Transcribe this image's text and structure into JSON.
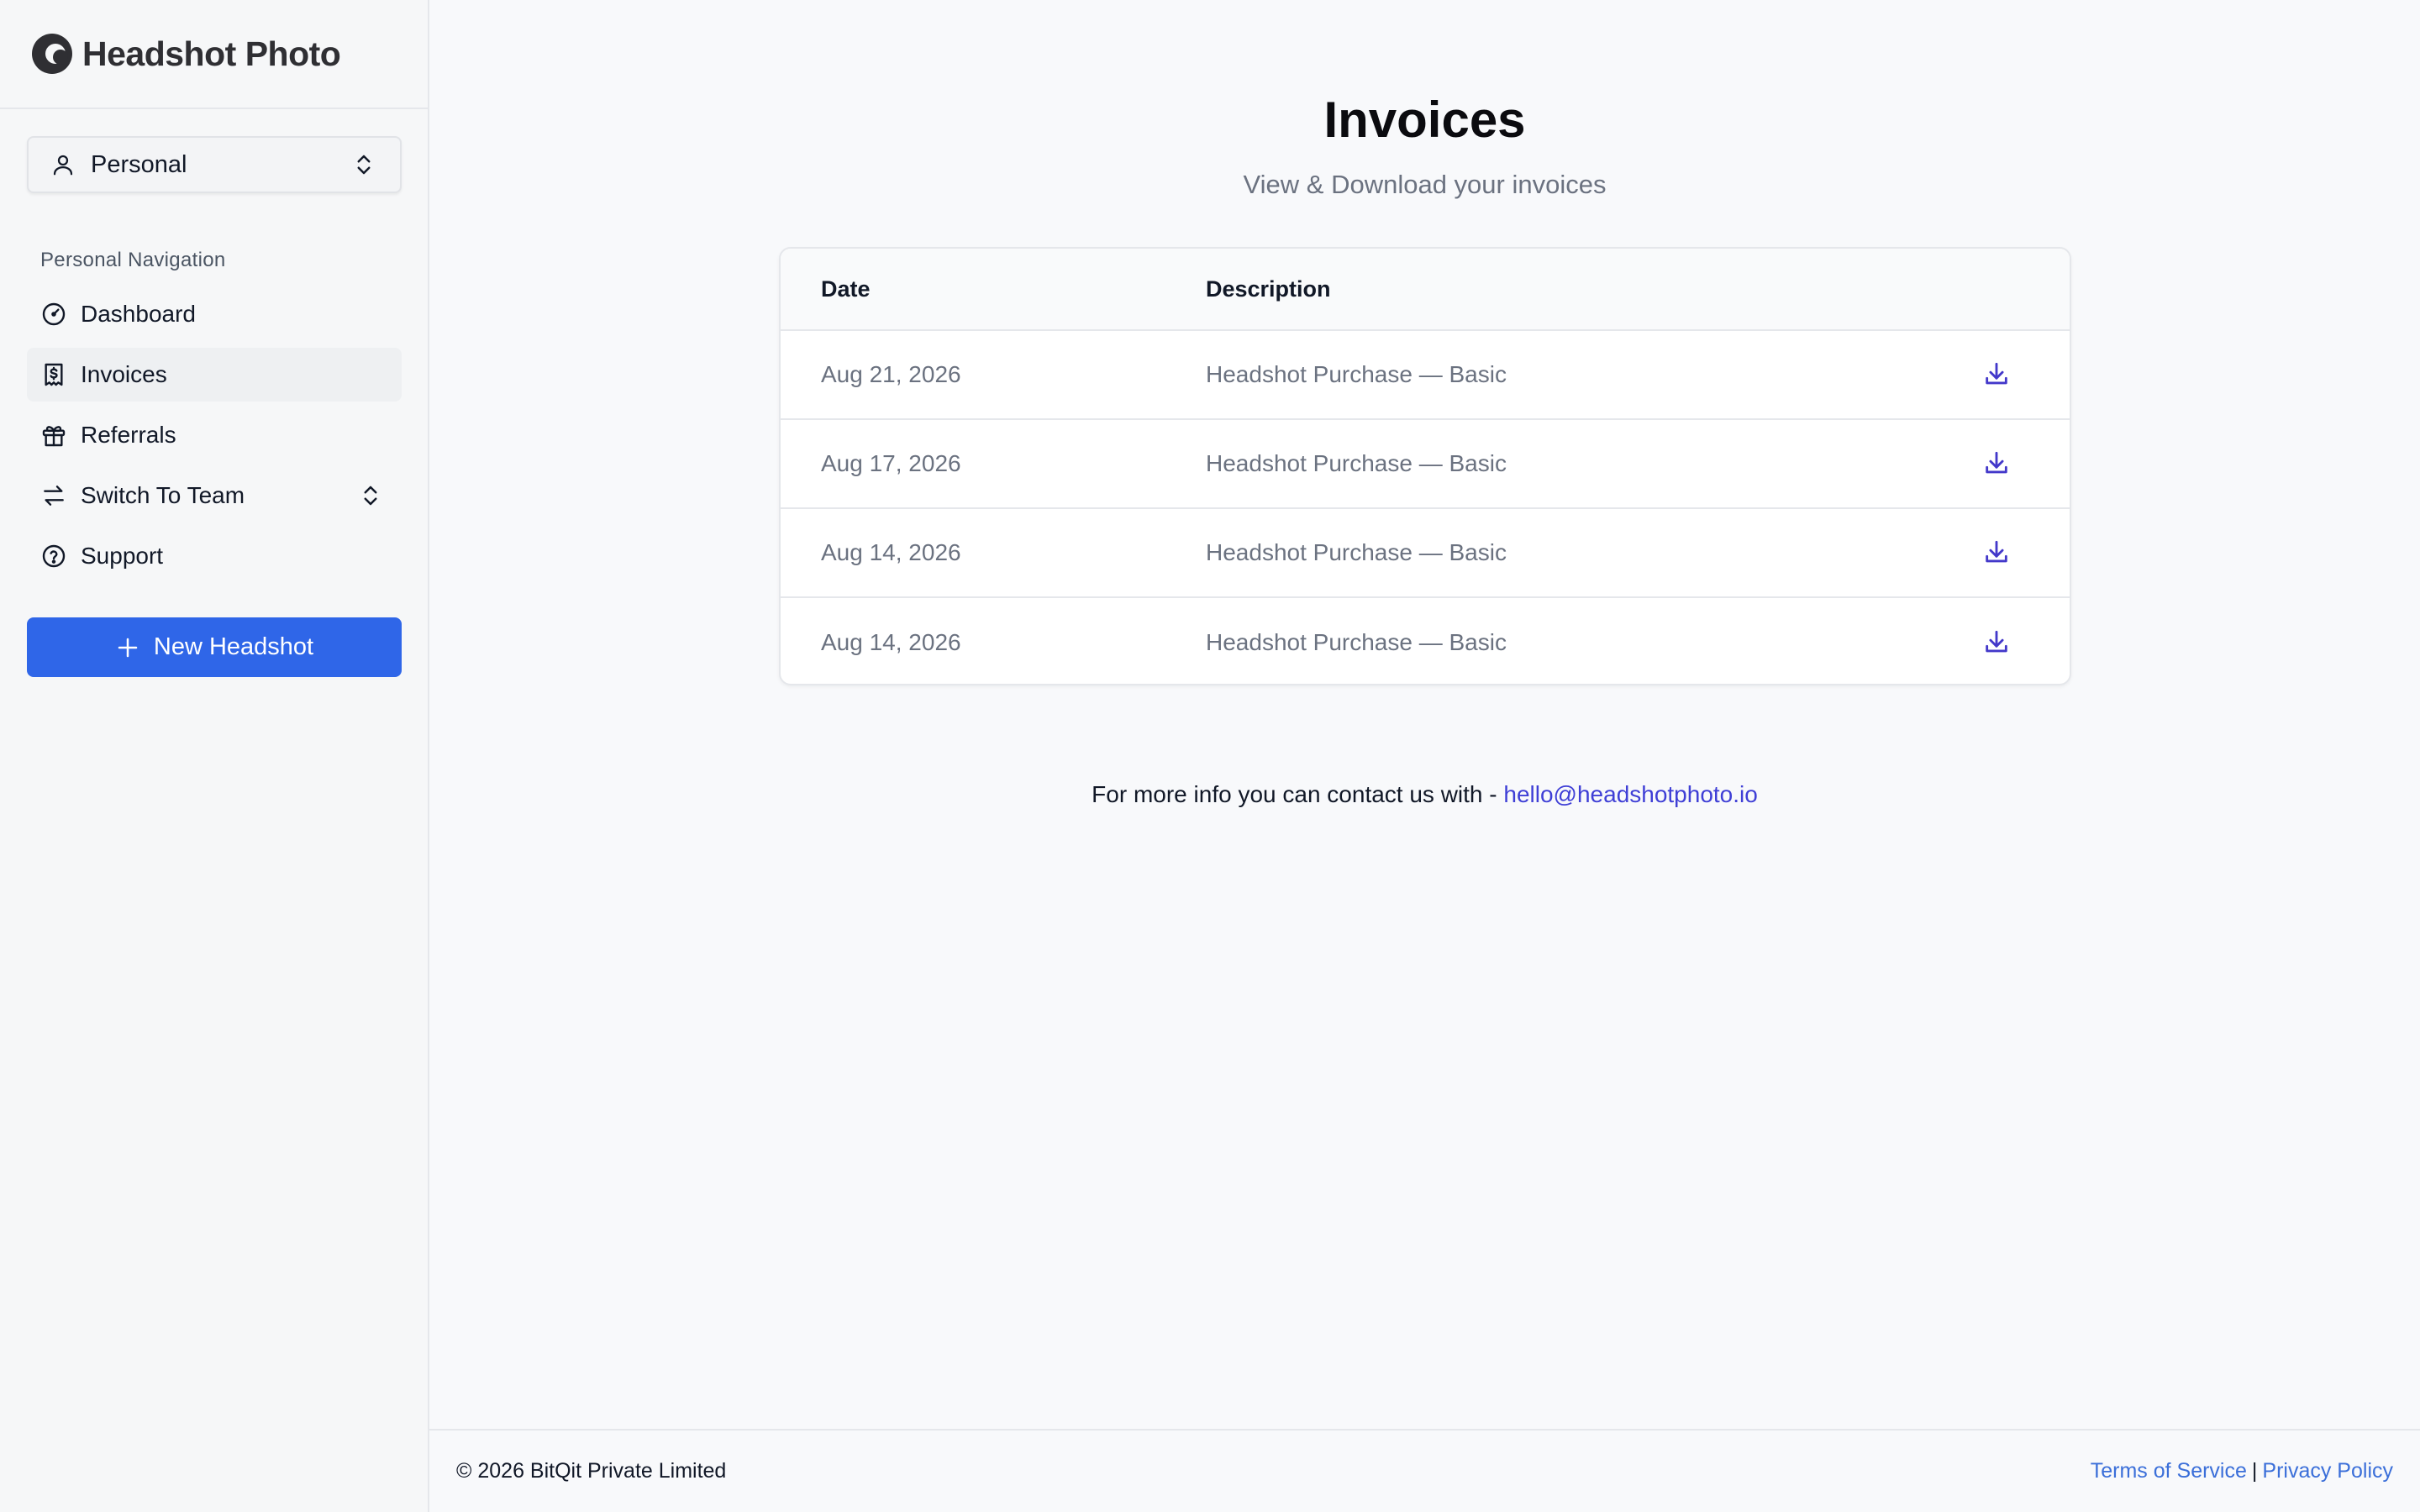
{
  "brand": {
    "name": "Headshot Photo",
    "icon": "headshot-logo-icon"
  },
  "account_selector": {
    "value": "Personal",
    "icon": "user-icon"
  },
  "sidebar": {
    "heading": "Personal Navigation",
    "items": [
      {
        "label": "Dashboard",
        "icon": "gauge-icon",
        "active": false
      },
      {
        "label": "Invoices",
        "icon": "receipt-icon",
        "active": true
      },
      {
        "label": "Referrals",
        "icon": "gift-icon",
        "active": false
      },
      {
        "label": "Switch To Team",
        "icon": "switch-arrows-icon",
        "active": false
      },
      {
        "label": "Support",
        "icon": "help-circle-icon",
        "active": false
      }
    ],
    "new_button": "New Headshot"
  },
  "main": {
    "title": "Invoices",
    "subtitle": "View & Download your invoices"
  },
  "table": {
    "headers": [
      "Date",
      "Description"
    ],
    "rows": [
      {
        "date": "Aug 21, 2026",
        "description": "Headshot Purchase — Basic"
      },
      {
        "date": "Aug 17, 2026",
        "description": "Headshot Purchase — Basic"
      },
      {
        "date": "Aug 14, 2026",
        "description": "Headshot Purchase — Basic"
      },
      {
        "date": "Aug 14, 2026",
        "description": "Headshot Purchase — Basic"
      }
    ]
  },
  "contact": {
    "text": "For more info you can contact us with - ",
    "email": "hello@headshotphoto.io"
  },
  "footer": {
    "copyright": "© 2026 BitQit Private Limited",
    "terms": "Terms of Service",
    "separator": "|",
    "privacy": "Privacy Policy"
  },
  "colors": {
    "accent": "#2f66e8",
    "link": "#3f3fd6",
    "download_icon": "#4338ca"
  }
}
